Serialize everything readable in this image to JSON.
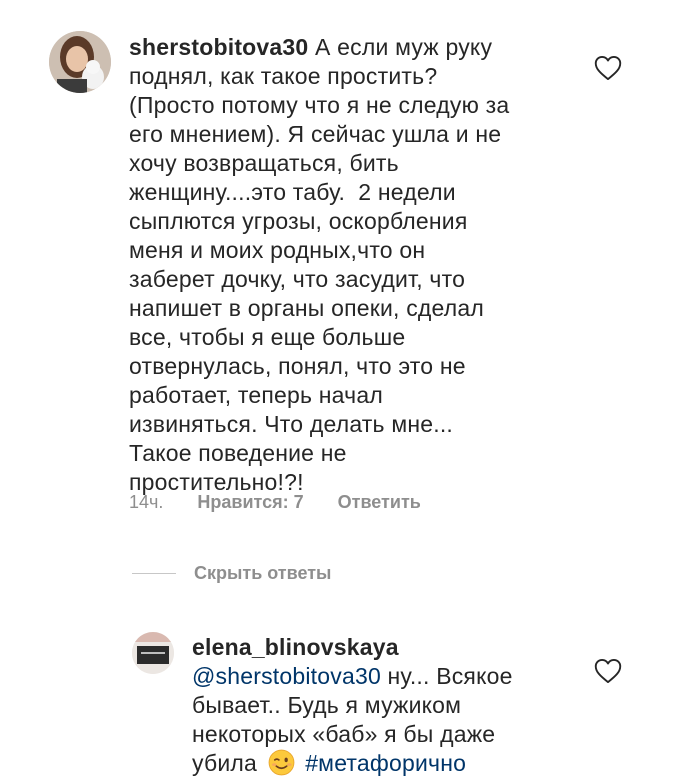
{
  "comment": {
    "username": "sherstobitova30",
    "lines": [
      "А если муж руку",
      "поднял, как такое простить?",
      "(Просто потому что я не следую за",
      "его мнением). Я сейчас ушла и не",
      "хочу возвращаться, бить",
      "женщину....это табу.  2 недели",
      "сыплются угрозы, оскорбления",
      "меня и моих родных,что он",
      "заберет дочку, что засудит, что",
      "напишет в органы опеки, сделал",
      "все, чтобы я еще больше",
      "отвернулась, понял, что это не",
      "работает, теперь начал",
      "извиняться. Что делать мне...",
      "Такое поведение не",
      "простительно!?!"
    ],
    "time": "14ч.",
    "likes": "Нравится: 7",
    "reply": "Ответить",
    "like_icon": "heart-outline-icon"
  },
  "hide_replies": "Скрыть ответы",
  "reply_comment": {
    "username": "elena_blinovskaya",
    "mention": "@sherstobitova30",
    "line1_rest": " ну... Всякое",
    "line2": "бывает.. Будь я мужиком",
    "line3": "некоторых «баб» я бы даже",
    "line4_text": "убила",
    "emoji": "winking-face",
    "hashtag": "#метафорично",
    "like_icon": "heart-outline-icon"
  },
  "colors": {
    "text": "#262626",
    "muted": "#8e8e8e",
    "link": "#003569"
  }
}
